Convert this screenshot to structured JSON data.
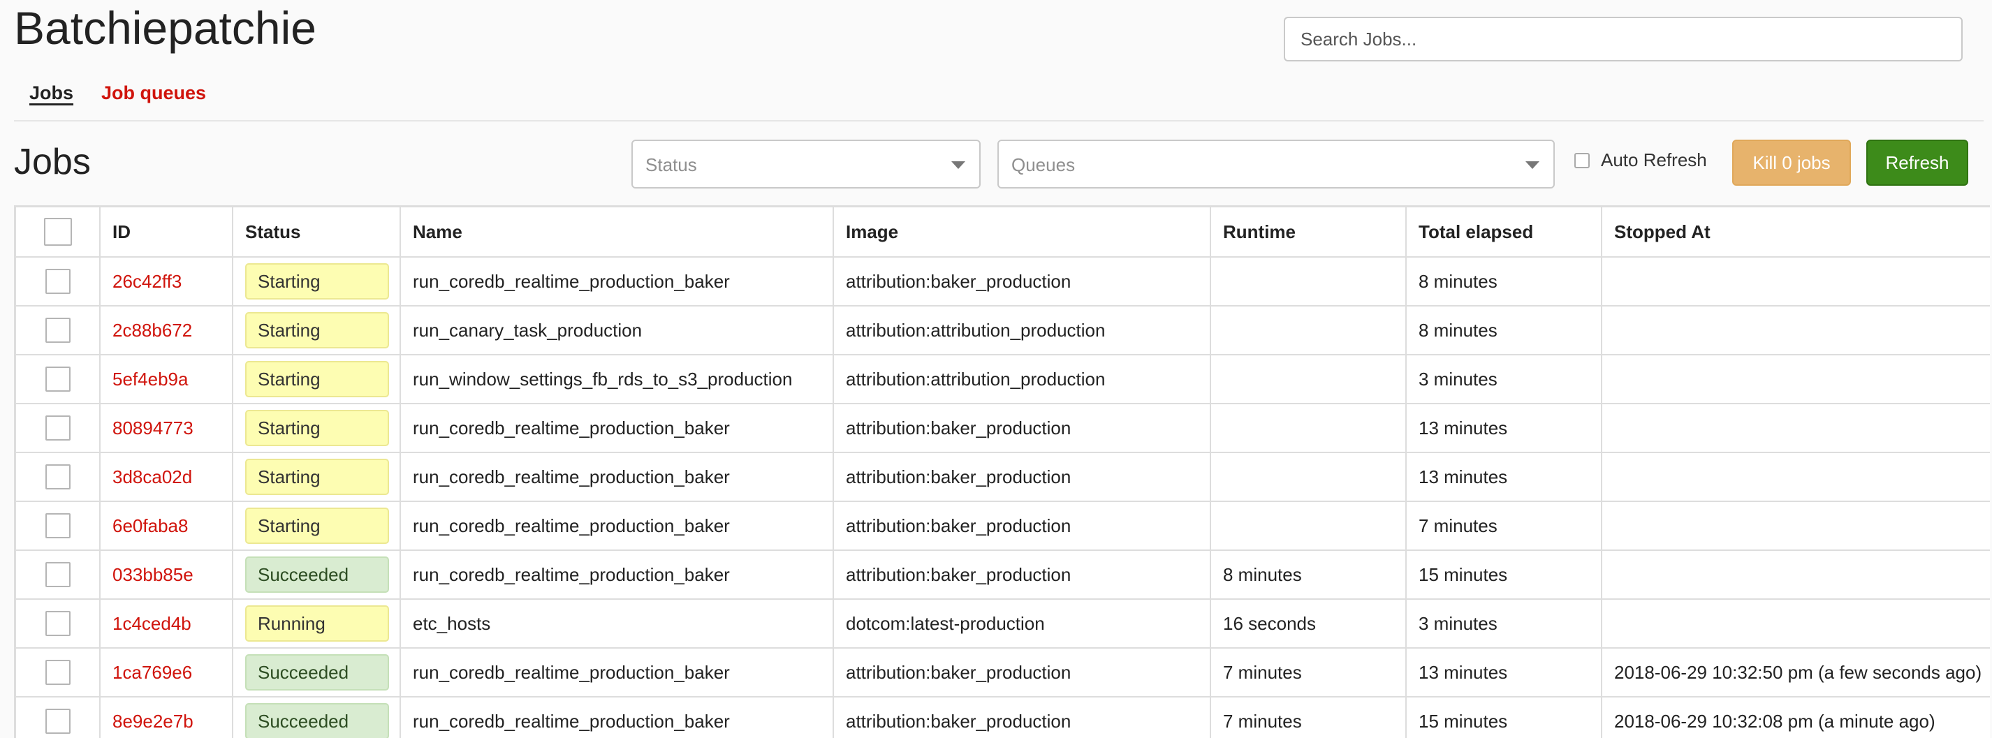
{
  "header": {
    "app_title": "Batchiepatchie",
    "search_placeholder": "Search Jobs..."
  },
  "nav": {
    "items": [
      {
        "label": "Jobs",
        "active": true
      },
      {
        "label": "Job queues",
        "active": false
      }
    ]
  },
  "toolbar": {
    "section_title": "Jobs",
    "status_placeholder": "Status",
    "queues_placeholder": "Queues",
    "auto_refresh_label": "Auto Refresh",
    "kill_label": "Kill 0 jobs",
    "refresh_label": "Refresh"
  },
  "colors": {
    "accent_red": "#d0140c",
    "kill_button": "#e7b36c",
    "refresh_button": "#3d8b1a",
    "status_starting": "#fdfdb2",
    "status_running": "#fdfdb2",
    "status_succeeded": "#d9ecd1"
  },
  "table": {
    "columns": [
      "ID",
      "Status",
      "Name",
      "Image",
      "Runtime",
      "Total elapsed",
      "Stopped At"
    ],
    "rows": [
      {
        "id": "26c42ff3",
        "status": "Starting",
        "name": "run_coredb_realtime_production_baker",
        "image": "attribution:baker_production",
        "runtime": "",
        "total_elapsed": "8 minutes",
        "stopped_at": ""
      },
      {
        "id": "2c88b672",
        "status": "Starting",
        "name": "run_canary_task_production",
        "image": "attribution:attribution_production",
        "runtime": "",
        "total_elapsed": "8 minutes",
        "stopped_at": ""
      },
      {
        "id": "5ef4eb9a",
        "status": "Starting",
        "name": "run_window_settings_fb_rds_to_s3_production",
        "image": "attribution:attribution_production",
        "runtime": "",
        "total_elapsed": "3 minutes",
        "stopped_at": ""
      },
      {
        "id": "80894773",
        "status": "Starting",
        "name": "run_coredb_realtime_production_baker",
        "image": "attribution:baker_production",
        "runtime": "",
        "total_elapsed": "13 minutes",
        "stopped_at": ""
      },
      {
        "id": "3d8ca02d",
        "status": "Starting",
        "name": "run_coredb_realtime_production_baker",
        "image": "attribution:baker_production",
        "runtime": "",
        "total_elapsed": "13 minutes",
        "stopped_at": ""
      },
      {
        "id": "6e0faba8",
        "status": "Starting",
        "name": "run_coredb_realtime_production_baker",
        "image": "attribution:baker_production",
        "runtime": "",
        "total_elapsed": "7 minutes",
        "stopped_at": ""
      },
      {
        "id": "033bb85e",
        "status": "Succeeded",
        "name": "run_coredb_realtime_production_baker",
        "image": "attribution:baker_production",
        "runtime": "8 minutes",
        "total_elapsed": "15 minutes",
        "stopped_at": ""
      },
      {
        "id": "1c4ced4b",
        "status": "Running",
        "name": "etc_hosts",
        "image": "dotcom:latest-production",
        "runtime": "16 seconds",
        "total_elapsed": "3 minutes",
        "stopped_at": ""
      },
      {
        "id": "1ca769e6",
        "status": "Succeeded",
        "name": "run_coredb_realtime_production_baker",
        "image": "attribution:baker_production",
        "runtime": "7 minutes",
        "total_elapsed": "13 minutes",
        "stopped_at": "2018-06-29 10:32:50 pm (a few seconds ago)"
      },
      {
        "id": "8e9e2e7b",
        "status": "Succeeded",
        "name": "run_coredb_realtime_production_baker",
        "image": "attribution:baker_production",
        "runtime": "7 minutes",
        "total_elapsed": "15 minutes",
        "stopped_at": "2018-06-29 10:32:08 pm (a minute ago)"
      }
    ]
  }
}
